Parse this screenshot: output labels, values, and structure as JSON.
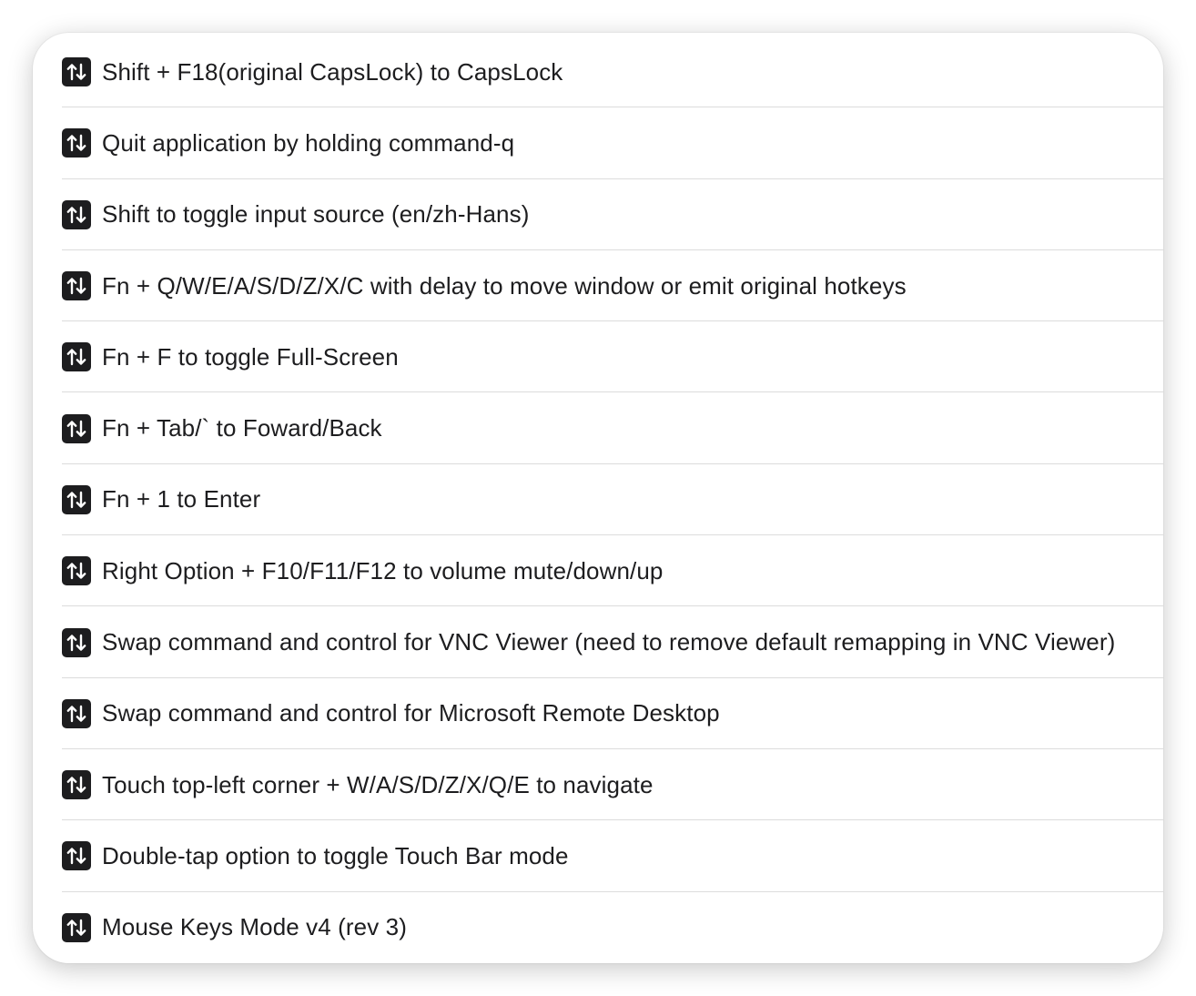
{
  "rules": {
    "icon": "swap-arrows-icon",
    "items": [
      {
        "label": "Shift + F18(original CapsLock) to CapsLock"
      },
      {
        "label": "Quit application by holding command-q"
      },
      {
        "label": "Shift to toggle input source (en/zh-Hans)"
      },
      {
        "label": "Fn + Q/W/E/A/S/D/Z/X/C with delay to move window or emit original hotkeys"
      },
      {
        "label": "Fn + F to toggle Full-Screen"
      },
      {
        "label": "Fn + Tab/` to Foward/Back"
      },
      {
        "label": "Fn + 1 to Enter"
      },
      {
        "label": "Right Option + F10/F11/F12 to volume mute/down/up"
      },
      {
        "label": "Swap command and control for VNC Viewer (need to remove default remapping in VNC Viewer)"
      },
      {
        "label": "Swap command and control for Microsoft Remote Desktop"
      },
      {
        "label": "Touch top-left corner + W/A/S/D/Z/X/Q/E to navigate"
      },
      {
        "label": "Double-tap option to toggle Touch Bar mode"
      },
      {
        "label": "Mouse Keys Mode v4 (rev 3)"
      }
    ]
  }
}
